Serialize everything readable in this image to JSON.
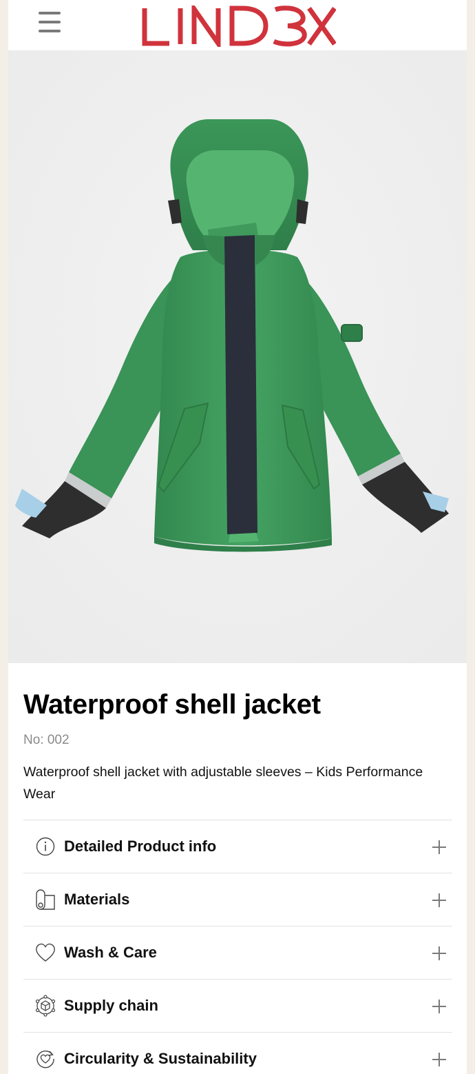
{
  "header": {
    "logo_text": "LINDEX",
    "logo_color": "#d0333c",
    "menu_icon": "hamburger-icon"
  },
  "product": {
    "title": "Waterproof shell jacket",
    "article_no": "No: 002",
    "description": "Waterproof shell jacket with adjustable sleeves – Kids Performance Wear",
    "image_alt": "Green waterproof kids shell jacket with navy zip placket and black cuffs"
  },
  "accordion": [
    {
      "label": "Detailed Product info",
      "icon": "info-icon"
    },
    {
      "label": "Materials",
      "icon": "fabric-roll-icon"
    },
    {
      "label": "Wash & Care",
      "icon": "heart-icon"
    },
    {
      "label": "Supply chain",
      "icon": "supply-chain-icon"
    },
    {
      "label": "Circularity & Sustainability",
      "icon": "circular-heart-icon"
    }
  ],
  "colors": {
    "jacket_green": "#3f9a5c",
    "placket_navy": "#2a2f3b",
    "cuff_black": "#2c2c2c",
    "tab_blue": "#a7cfe8"
  }
}
